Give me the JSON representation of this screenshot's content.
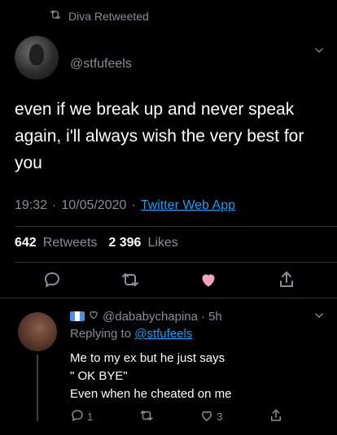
{
  "retweet_banner": {
    "text": "Diva Retweeted"
  },
  "main_tweet": {
    "handle": "@stfufeels",
    "text": "even if we break up and never speak again, i'll always wish the very best for you",
    "time": "19:32",
    "date": "10/05/2020",
    "separator": "·",
    "client": "Twitter Web App",
    "retweets_count": "642",
    "retweets_label": "Retweets",
    "likes_count": "2 396",
    "likes_label": "Likes"
  },
  "reply": {
    "handle": "@dababychapina",
    "time_ago": "5h",
    "separator": "·",
    "replying_prefix": "Replying to",
    "replying_handle": "@stfufeels",
    "text": "Me to my ex but he just says\n\" OK BYE\"\nEven when he cheated on  me",
    "reply_count": "1",
    "like_count": "3"
  },
  "colors": {
    "background": "#000000",
    "muted": "#8a8d91",
    "link": "#1d9bf0",
    "liked": "#f4a5be",
    "divider": "#2f3336"
  },
  "icons": {
    "retweet_banner": "retweet-icon",
    "more": "chevron-down-icon",
    "reply": "reply-icon",
    "retweet": "retweet-icon",
    "like": "heart-icon",
    "share": "share-icon",
    "flag": "flag-icon"
  }
}
